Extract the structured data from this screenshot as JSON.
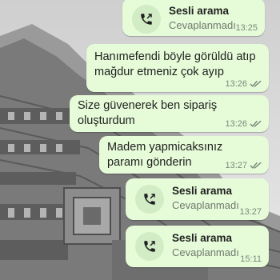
{
  "colors": {
    "bubble": "#e6fbd8",
    "icon_circle": "#d2ecc6",
    "tick_read": "#6f7f6f"
  },
  "messages": [
    {
      "type": "call",
      "icon": "missed-voice-call-icon",
      "title": "Sesli arama",
      "subtitle": "Cevaplanmadı",
      "time": "13:25"
    },
    {
      "type": "text",
      "text": "Hanımefendi böyle görüldü atıp mağdur etmeniz çok ayıp",
      "time": "13:26",
      "status": "read-ticks"
    },
    {
      "type": "text",
      "text": "Size güvenerek ben sipariş oluşturdum",
      "time": "13:26",
      "status": "read-ticks"
    },
    {
      "type": "text",
      "text": "Madem yapmicaksınız paramı gönderin",
      "time": "13:27",
      "status": "read-ticks"
    },
    {
      "type": "call",
      "icon": "missed-voice-call-icon",
      "title": "Sesli arama",
      "subtitle": "Cevaplanmadı",
      "time": "13:27"
    },
    {
      "type": "call",
      "icon": "missed-voice-call-icon",
      "title": "Sesli arama",
      "subtitle": "Cevaplanmadı",
      "time": "15:11"
    }
  ]
}
